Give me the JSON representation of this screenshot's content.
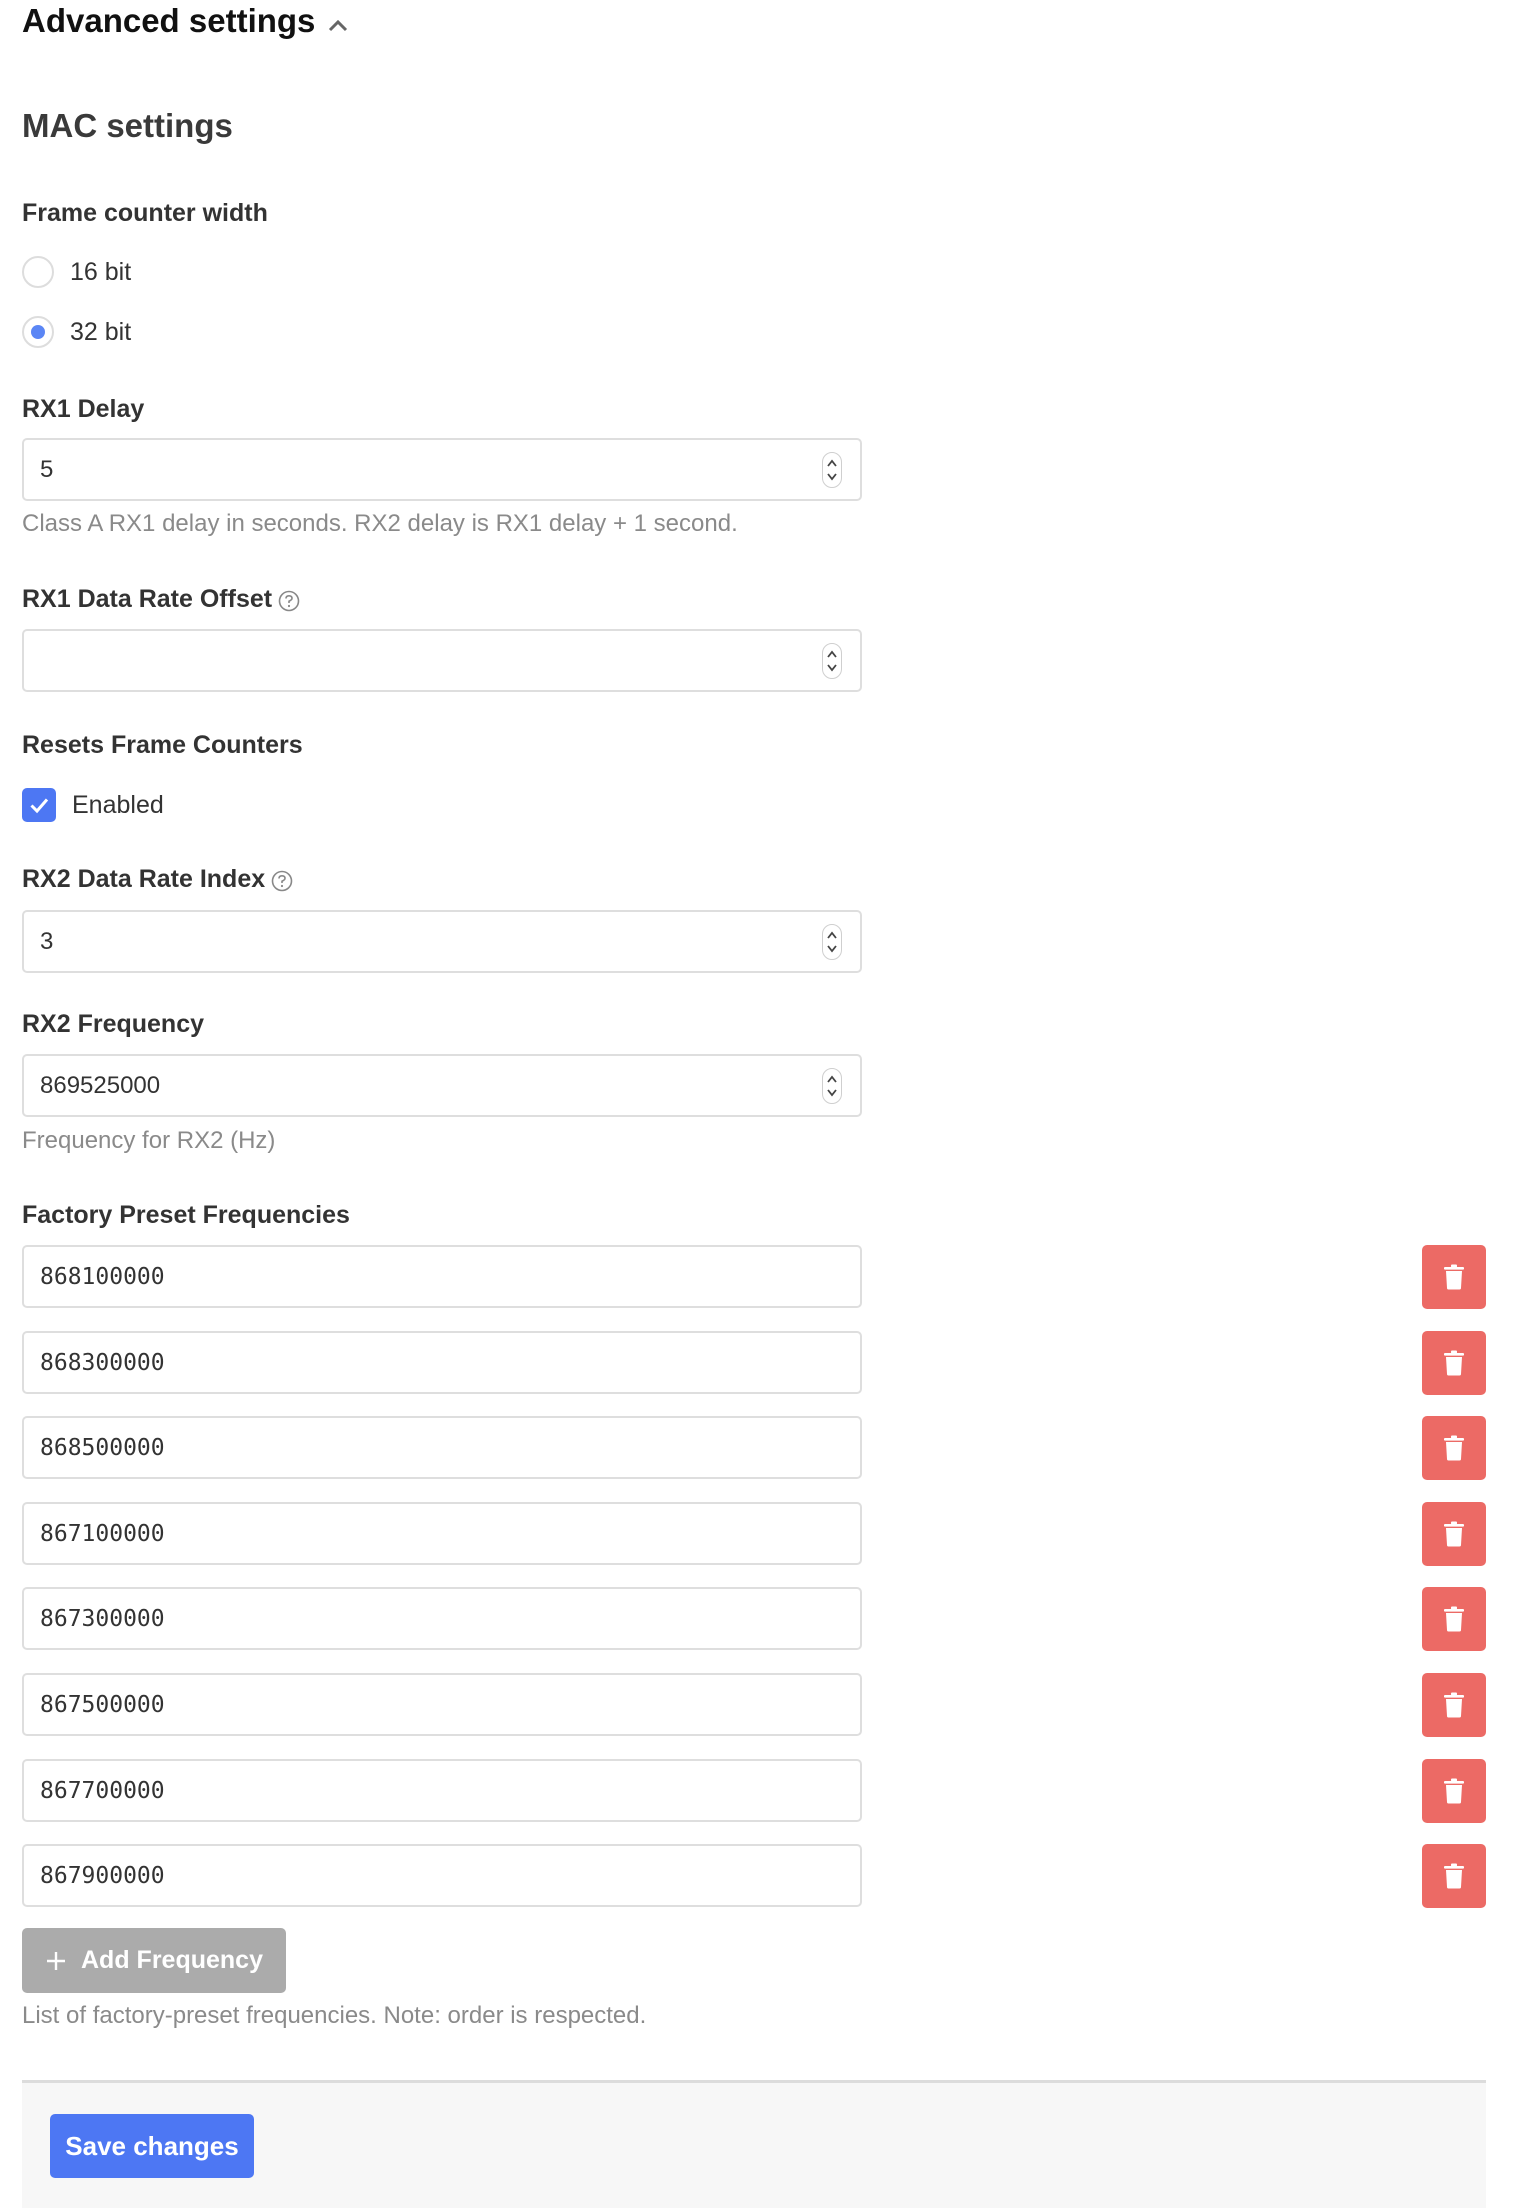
{
  "section": {
    "title": "Advanced settings",
    "collapse_icon": "chevron-up-icon"
  },
  "mac": {
    "title": "MAC settings",
    "frame_counter_width": {
      "label": "Frame counter width",
      "options": [
        {
          "label": "16 bit",
          "selected": false
        },
        {
          "label": "32 bit",
          "selected": true
        }
      ]
    },
    "rx1_delay": {
      "label": "RX1 Delay",
      "value": "5",
      "hint": "Class A RX1 delay in seconds. RX2 delay is RX1 delay + 1 second."
    },
    "rx1_data_rate_offset": {
      "label": "RX1 Data Rate Offset",
      "help_icon": "question-circle-icon",
      "value": ""
    },
    "resets_frame_counters": {
      "label": "Resets Frame Counters",
      "checkbox_label": "Enabled",
      "checked": true
    },
    "rx2_data_rate_index": {
      "label": "RX2 Data Rate Index",
      "help_icon": "question-circle-icon",
      "value": "3"
    },
    "rx2_frequency": {
      "label": "RX2 Frequency",
      "value": "869525000",
      "hint": "Frequency for RX2 (Hz)"
    },
    "factory_preset_frequencies": {
      "label": "Factory Preset Frequencies",
      "items": [
        "868100000",
        "868300000",
        "868500000",
        "867100000",
        "867300000",
        "867500000",
        "867700000",
        "867900000"
      ],
      "delete_icon": "trash-icon",
      "add_label": "Add Frequency",
      "hint": "List of factory-preset frequencies. Note: order is respected."
    }
  },
  "footer": {
    "save_label": "Save changes"
  },
  "colors": {
    "primary": "#4d77f3",
    "danger": "#ec6a65",
    "disabled": "#ababab",
    "footer_bg": "#f7f7f7"
  }
}
